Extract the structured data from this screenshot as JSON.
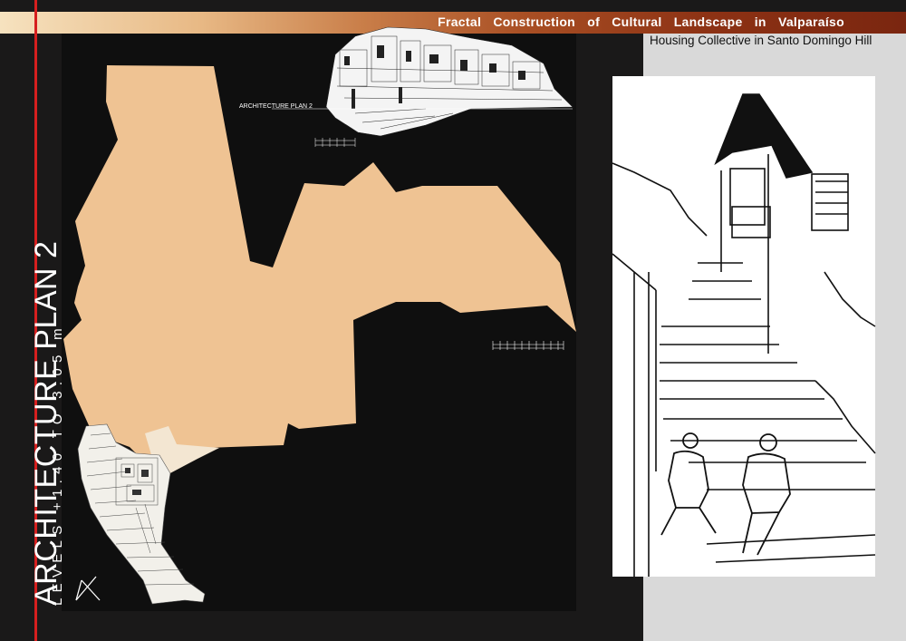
{
  "header": {
    "title": "Fractal Construction of Cultural Landscape in Valparaíso",
    "subtitle": "Housing Collective in Santo Domingo Hill"
  },
  "sidebar": {
    "plan_title": "ARCHITECTURE PLAN 2",
    "levels_text": "LEVELS +1.40 TO 3.05 m"
  },
  "section": {
    "label": "ARCHITECTURE PLAN 2"
  },
  "colors": {
    "background": "#1a1919",
    "plan_fill": "#efc393",
    "accent_line": "#d61f1f",
    "header_gradient_start": "#f6e2bf",
    "header_gradient_end": "#7a2610",
    "right_panel": "#d9d9d9"
  },
  "icons": {
    "north_arrow": "north-arrow-icon"
  }
}
